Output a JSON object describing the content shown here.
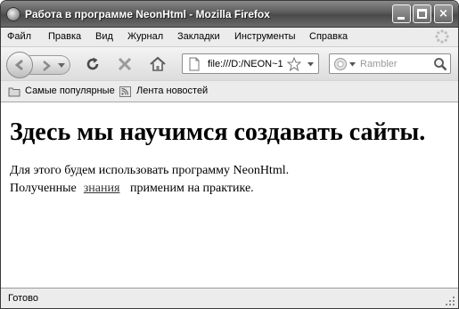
{
  "window": {
    "title": "Работа в программе NeonHtml - Mozilla Firefox",
    "buttons": {
      "minimize": "minimize-icon",
      "maximize": "maximize-icon",
      "close": "×"
    }
  },
  "menu": [
    "Файл",
    "Правка",
    "Вид",
    "Журнал",
    "Закладки",
    "Инструменты",
    "Справка"
  ],
  "nav": {
    "url": "file:///D:/NEON~1",
    "search_placeholder": "Rambler",
    "icons": [
      "back-icon",
      "forward-icon",
      "reload-icon",
      "stop-icon",
      "home-icon",
      "page-icon",
      "star-icon",
      "search-engine-icon",
      "magnifier-icon"
    ]
  },
  "bookmarks": [
    "Самые популярные",
    "Лента новостей"
  ],
  "page": {
    "heading": "Здесь мы научимся создавать сайты.",
    "line1": "Для этого будем использовать программу NeonHtml.",
    "line2_before": "Полученные",
    "link": "знания",
    "line2_after": "применим на практике."
  },
  "status": "Готово"
}
